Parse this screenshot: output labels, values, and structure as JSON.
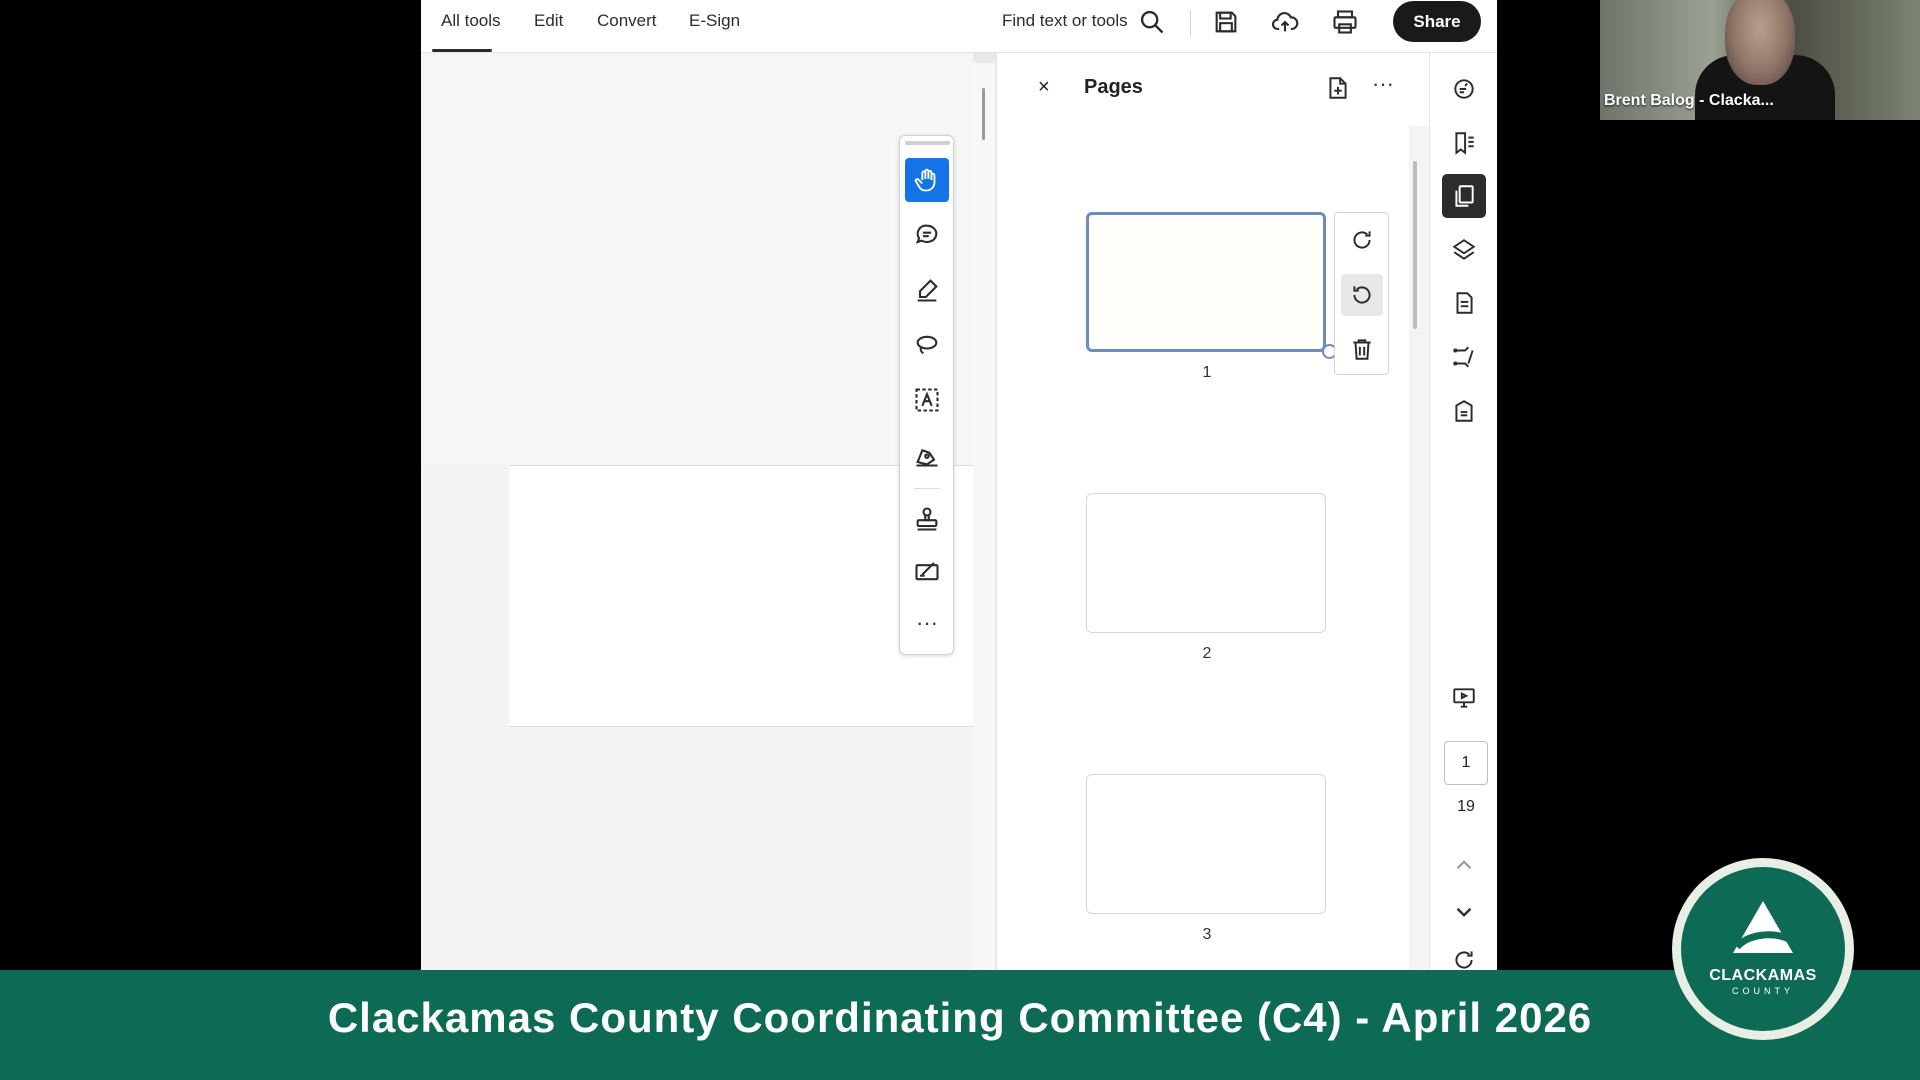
{
  "toolbar": {
    "tabs": [
      {
        "label": "All tools",
        "active": true
      },
      {
        "label": "Edit"
      },
      {
        "label": "Convert"
      },
      {
        "label": "E-Sign"
      }
    ],
    "search_label": "Find text or tools",
    "share_label": "Share"
  },
  "tools": {
    "icons": [
      "hand-icon",
      "comment-icon",
      "highlight-icon",
      "lasso-icon",
      "text-box-icon",
      "sign-icon",
      "stamp-icon",
      "redact-icon"
    ],
    "more_label": "···"
  },
  "pages_panel": {
    "title": "Pages",
    "close_label": "×",
    "more_label": "···",
    "pages": [
      {
        "number": "1",
        "selected": true
      },
      {
        "number": "2"
      },
      {
        "number": "3"
      }
    ],
    "actions": [
      "rotate-clockwise",
      "rotate-counterclockwise",
      "delete"
    ]
  },
  "rail": {
    "current_page": "1",
    "total_pages": "19",
    "icons": [
      "ai-assistant-icon",
      "bookmarks-icon",
      "pages-icon",
      "layers-icon",
      "attachments-icon",
      "compare-icon",
      "security-icon",
      "present-icon"
    ]
  },
  "webcam": {
    "name": "Brent Balog - Clacka..."
  },
  "banner": {
    "title": "Clackamas County Coordinating Committee (C4) - April 2026"
  },
  "logo": {
    "text": "CLACKAMAS",
    "subtext": "COUNTY"
  },
  "colors": {
    "accent_blue": "#1473e6",
    "banner_green": "#0d6b55",
    "selection_outline": "#6c8cbe",
    "share_button": "#1a1a1a"
  }
}
